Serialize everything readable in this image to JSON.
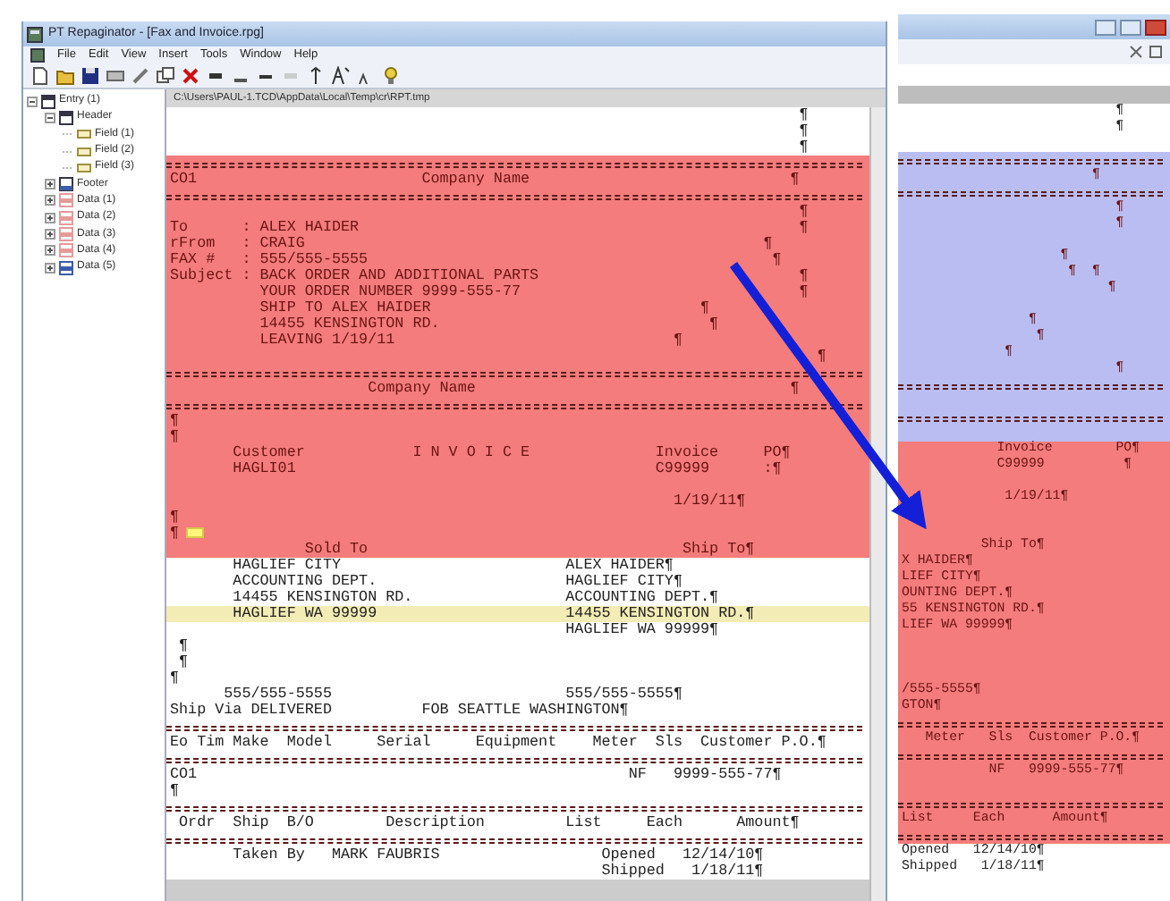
{
  "main_window": {
    "title": "PT Repaginator - [Fax and Invoice.rpg]",
    "menu": [
      "File",
      "Edit",
      "View",
      "Insert",
      "Tools",
      "Window",
      "Help"
    ],
    "tree": [
      {
        "label": "Entry (1)",
        "kind": "entry",
        "expanded": true,
        "children": [
          {
            "label": "Header",
            "kind": "header",
            "expanded": true,
            "children": [
              {
                "label": "Field (1)",
                "kind": "field"
              },
              {
                "label": "Field (2)",
                "kind": "field"
              },
              {
                "label": "Field (3)",
                "kind": "field"
              }
            ]
          },
          {
            "label": "Footer",
            "kind": "footer",
            "expanded": false
          },
          {
            "label": "Data (1)",
            "kind": "data",
            "color": "#e59a9a",
            "expanded": false
          },
          {
            "label": "Data (2)",
            "kind": "data",
            "color": "#e59a9a",
            "expanded": false
          },
          {
            "label": "Data (3)",
            "kind": "data",
            "color": "#e59a9a",
            "expanded": false
          },
          {
            "label": "Data (4)",
            "kind": "data",
            "color": "#e59a9a",
            "expanded": false
          },
          {
            "label": "Data (5)",
            "kind": "data",
            "color": "#3b5ca8",
            "expanded": false
          }
        ]
      }
    ],
    "path": "C:\\Users\\PAUL-1.TCD\\AppData\\Local\\Temp\\cr\\RPT.tmp",
    "sections": [
      {
        "color": "#ffffff",
        "lines": [
          {
            "kind": "text",
            "text": "                                                                      ¶"
          },
          {
            "kind": "text",
            "text": "                                                                      ¶"
          },
          {
            "kind": "text",
            "text": "                                                                      ¶"
          }
        ]
      },
      {
        "color": "#f47c7c",
        "lines": [
          {
            "kind": "rule"
          },
          {
            "kind": "text",
            "text": "CO1                         Company Name                             ¶"
          },
          {
            "kind": "rule"
          },
          {
            "kind": "text",
            "text": "                                                                      ¶"
          },
          {
            "kind": "text",
            "text": "To      : ALEX HAIDER                                                 ¶"
          },
          {
            "kind": "text",
            "text": "rFrom   : CRAIG                                                   ¶"
          },
          {
            "kind": "text",
            "text": "FAX #   : 555/555-5555                                             ¶"
          },
          {
            "kind": "text",
            "text": "Subject : BACK ORDER AND ADDITIONAL PARTS                             ¶"
          },
          {
            "kind": "text",
            "text": "          YOUR ORDER NUMBER 9999-555-77                               ¶"
          },
          {
            "kind": "text",
            "text": "          SHIP TO ALEX HAIDER                              ¶"
          },
          {
            "kind": "text",
            "text": "          14455 KENSINGTON RD.                              ¶"
          },
          {
            "kind": "text",
            "text": "          LEAVING 1/19/11                               ¶"
          },
          {
            "kind": "text",
            "text": "                                                                        ¶"
          },
          {
            "kind": "rule"
          },
          {
            "kind": "text",
            "text": "                      Company Name                                   ¶"
          },
          {
            "kind": "rule"
          },
          {
            "kind": "text",
            "text": "¶"
          },
          {
            "kind": "text",
            "text": "¶"
          },
          {
            "kind": "text",
            "text": "       Customer            I N V O I C E              Invoice     PO¶"
          },
          {
            "kind": "text",
            "text": "       HAGLI01                                        C99999      :¶"
          },
          {
            "kind": "blank"
          },
          {
            "kind": "text",
            "text": "                                                        1/19/11¶"
          },
          {
            "kind": "text",
            "text": "¶"
          },
          {
            "kind": "marker",
            "text": "¶"
          },
          {
            "kind": "text",
            "text": "               Sold To                                   Ship To¶"
          }
        ]
      },
      {
        "color": "#ffffff",
        "lines": [
          {
            "kind": "text",
            "text": "       HAGLIEF CITY                         ALEX HAIDER¶"
          },
          {
            "kind": "text",
            "text": "       ACCOUNTING DEPT.                     HAGLIEF CITY¶"
          },
          {
            "kind": "text",
            "text": "       14455 KENSINGTON RD.                 ACCOUNTING DEPT.¶"
          },
          {
            "kind": "current",
            "text": "       HAGLIEF WA 99999                     14455 KENSINGTON RD.¶"
          },
          {
            "kind": "text",
            "text": "                                            HAGLIEF WA 99999¶"
          },
          {
            "kind": "text",
            "text": " ¶"
          },
          {
            "kind": "text",
            "text": " ¶"
          },
          {
            "kind": "text",
            "text": "¶"
          },
          {
            "kind": "text",
            "text": "      555/555-5555                          555/555-5555¶"
          },
          {
            "kind": "text",
            "text": "Ship Via DELIVERED          FOB SEATTLE WASHINGTON¶"
          },
          {
            "kind": "rule"
          },
          {
            "kind": "text",
            "text": "Eo Tim Make  Model     Serial     Equipment    Meter  Sls  Customer P.O.¶"
          },
          {
            "kind": "rule"
          },
          {
            "kind": "text",
            "text": "CO1                                                NF   9999-555-77¶"
          },
          {
            "kind": "text",
            "text": "¶"
          },
          {
            "kind": "rule"
          },
          {
            "kind": "text",
            "text": " Ordr  Ship  B/O        Description         List     Each      Amount¶"
          },
          {
            "kind": "rule"
          },
          {
            "kind": "text",
            "text": "       Taken By   MARK FAUBRIS                  Opened   12/14/10¶"
          },
          {
            "kind": "text",
            "text": "                                                Shipped   1/18/11¶"
          }
        ]
      }
    ]
  },
  "second_window": {
    "sections": [
      {
        "color": "#ffffff",
        "lines": [
          {
            "kind": "text",
            "text": "                           ¶"
          },
          {
            "kind": "text",
            "text": "                           ¶"
          },
          {
            "kind": "blank"
          }
        ]
      },
      {
        "color": "#b9bdf2",
        "lines": [
          {
            "kind": "rule"
          },
          {
            "kind": "text",
            "text": "                        ¶"
          },
          {
            "kind": "rule"
          },
          {
            "kind": "text",
            "text": "                           ¶"
          },
          {
            "kind": "text",
            "text": "                           ¶"
          },
          {
            "kind": "blank"
          },
          {
            "kind": "text",
            "text": "                    ¶"
          },
          {
            "kind": "text",
            "text": "                     ¶  ¶"
          },
          {
            "kind": "text",
            "text": "                          ¶"
          },
          {
            "kind": "blank"
          },
          {
            "kind": "text",
            "text": "                ¶"
          },
          {
            "kind": "text",
            "text": "                 ¶"
          },
          {
            "kind": "text",
            "text": "             ¶"
          },
          {
            "kind": "text",
            "text": "                           ¶"
          },
          {
            "kind": "rule"
          },
          {
            "kind": "blank"
          },
          {
            "kind": "rule"
          },
          {
            "kind": "blank"
          }
        ]
      },
      {
        "color": "#f47c7c",
        "lines": [
          {
            "kind": "text",
            "text": "            Invoice        PO¶"
          },
          {
            "kind": "text",
            "text": "            C99999          ¶"
          },
          {
            "kind": "blank"
          },
          {
            "kind": "text",
            "text": "             1/19/11¶"
          },
          {
            "kind": "blank"
          },
          {
            "kind": "blank"
          },
          {
            "kind": "text",
            "text": "          Ship To¶"
          },
          {
            "kind": "text",
            "text": "X HAIDER¶"
          },
          {
            "kind": "text",
            "text": "LIEF CITY¶"
          },
          {
            "kind": "text",
            "text": "OUNTING DEPT.¶"
          },
          {
            "kind": "text",
            "text": "55 KENSINGTON RD.¶"
          },
          {
            "kind": "text",
            "text": "LIEF WA 99999¶"
          },
          {
            "kind": "blank"
          },
          {
            "kind": "blank"
          },
          {
            "kind": "blank"
          },
          {
            "kind": "text",
            "text": "/555-5555¶"
          },
          {
            "kind": "text",
            "text": "GTON¶"
          },
          {
            "kind": "rule"
          },
          {
            "kind": "text",
            "text": "   Meter   Sls  Customer P.O.¶"
          },
          {
            "kind": "rule"
          },
          {
            "kind": "text",
            "text": "           NF   9999-555-77¶"
          },
          {
            "kind": "blank"
          },
          {
            "kind": "rule"
          },
          {
            "kind": "text",
            "text": "List     Each      Amount¶"
          },
          {
            "kind": "rule"
          }
        ]
      },
      {
        "color": "#ffffff",
        "lines": [
          {
            "kind": "text",
            "text": "Opened   12/14/10¶"
          },
          {
            "kind": "text",
            "text": "Shipped   1/18/11¶"
          }
        ]
      }
    ]
  }
}
